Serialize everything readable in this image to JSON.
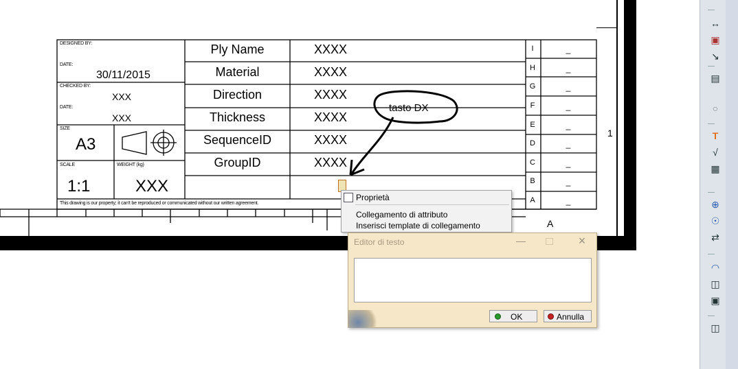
{
  "title_block": {
    "designed_by_label": "DESIGNED BY:",
    "date_label_1": "DATE:",
    "date_value": "30/11/2015",
    "checked_by_label": "CHECKED BY:",
    "checked_by_value": "XXX",
    "date_label_2": "DATE:",
    "date_value_2": "XXX",
    "size_label": "SIZE",
    "size_value": "A3",
    "scale_label": "SCALE",
    "scale_value": "1:1",
    "weight_label": "WEIGHT (kg)",
    "weight_value": "XXX",
    "disclaimer": "This drawing is our property; it can't be reproduced or communicated without our written agreement.",
    "rows": [
      {
        "label": "Ply Name",
        "value": "XXXX"
      },
      {
        "label": "Material",
        "value": "XXXX"
      },
      {
        "label": "Direction",
        "value": "XXXX"
      },
      {
        "label": "Thickness",
        "value": "XXXX"
      },
      {
        "label": "SequenceID",
        "value": "XXXX"
      },
      {
        "label": "GroupID",
        "value": "XXXX"
      }
    ],
    "revisions": [
      {
        "letter": "I",
        "value": "_"
      },
      {
        "letter": "H",
        "value": "_"
      },
      {
        "letter": "G",
        "value": "_"
      },
      {
        "letter": "F",
        "value": "_"
      },
      {
        "letter": "E",
        "value": "_"
      },
      {
        "letter": "D",
        "value": "_"
      },
      {
        "letter": "C",
        "value": "_"
      },
      {
        "letter": "B",
        "value": "_"
      },
      {
        "letter": "A",
        "value": "_"
      }
    ],
    "zone_number": "1",
    "zone_letter": "A"
  },
  "annotation": {
    "text": "tasto DX"
  },
  "context_menu": {
    "items": [
      "Proprietà",
      "Collegamento di attributo",
      "Inserisci template di collegamento"
    ]
  },
  "text_editor": {
    "title": "Editor di testo",
    "text_value": "",
    "ok_label": "OK",
    "cancel_label": "Annulla"
  },
  "toolbar": {
    "icons": [
      "dimension-icon",
      "datum-feature-icon",
      "cutting-plane-icon",
      "text-frame-icon",
      "balloon-icon",
      "text-icon",
      "symbol-icon",
      "table-icon",
      "center-line-icon",
      "thread-icon",
      "axis-icon",
      "arc-icon",
      "mirror-icon",
      "view-frame-icon",
      "positioning-icon"
    ]
  }
}
